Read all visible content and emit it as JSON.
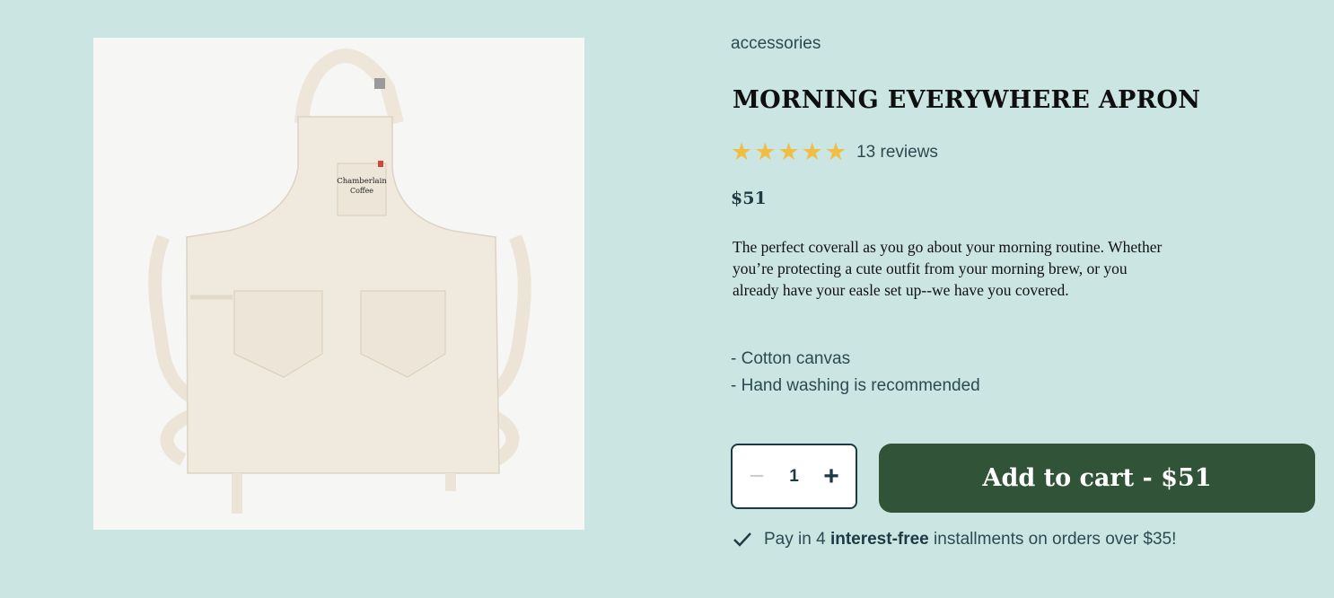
{
  "product": {
    "category": "accessories",
    "title": "MORNING EVERYWHERE APRON",
    "rating": {
      "stars": 5,
      "reviews_label": "13 reviews",
      "star_icon": "star-icon",
      "star_color": "#f0bd45"
    },
    "price": "$51",
    "description": "The perfect coverall as you go about your morning routine. Whether you’re protecting a cute outfit from your morning brew, or you already have your easle set up--we have you covered.",
    "features": [
      "- Cotton canvas",
      "- Hand washing is recommended"
    ],
    "image": {
      "logo_lines": [
        "Chamberlain",
        "Coffee"
      ]
    }
  },
  "purchase": {
    "quantity": "1",
    "minus_icon": "minus-icon",
    "plus_icon": "plus-icon",
    "add_to_cart_label": "Add to cart - $51",
    "button_color": "#315337"
  },
  "installments": {
    "icon": "check-icon",
    "prefix": "Pay in 4",
    "bold": "interest-free",
    "suffix": "installments on orders over $35!"
  },
  "colors": {
    "background": "#cbe5e2",
    "accent": "#315337"
  }
}
